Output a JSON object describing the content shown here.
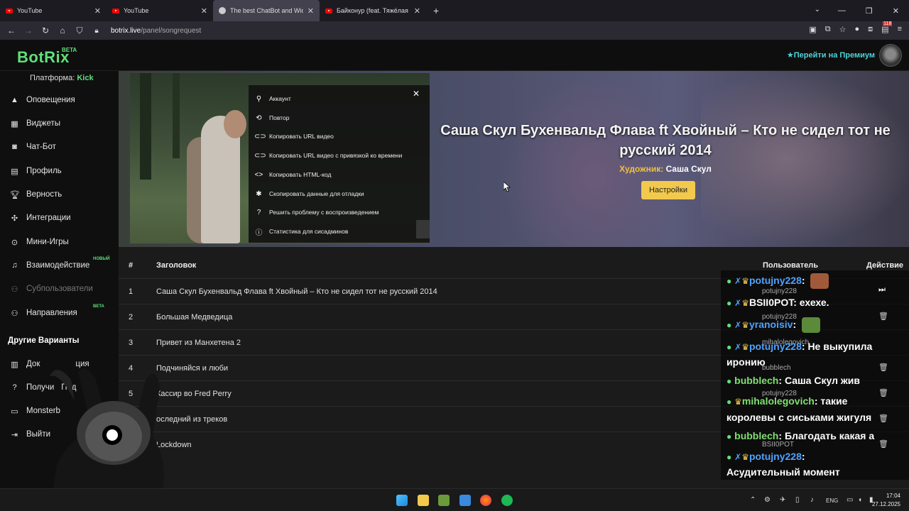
{
  "browser": {
    "tabs": [
      {
        "title": "YouTube",
        "icon": "youtube-icon"
      },
      {
        "title": "YouTube",
        "icon": "youtube-icon"
      },
      {
        "title": "The best ChatBot and Widg",
        "icon": "botrix-icon"
      },
      {
        "title": "Байконур (feat. Тяжёлая Атлет",
        "icon": "youtube-icon"
      }
    ],
    "url_host": "botrix.live",
    "url_path": "/panel/songrequest",
    "extension_badge": "118"
  },
  "app": {
    "logo": "BotRix",
    "logo_badge": "BETA",
    "premium_label": "Перейти на Премиум"
  },
  "sidebar": {
    "platform_label": "Платформа:",
    "platform_value": "Kick",
    "items": [
      {
        "label": "Оповещения",
        "icon": "warning-icon"
      },
      {
        "label": "Виджеты",
        "icon": "widgets-icon"
      },
      {
        "label": "Чат-Бот",
        "icon": "robot-icon"
      },
      {
        "label": "Профиль",
        "icon": "profile-card-icon"
      },
      {
        "label": "Верность",
        "icon": "trophy-icon"
      },
      {
        "label": "Интеграции",
        "icon": "integrations-icon"
      },
      {
        "label": "Мини-Игры",
        "icon": "gamepad-icon"
      },
      {
        "label": "Взаимодействие",
        "icon": "music-icon",
        "badge": "НОВЫЙ"
      },
      {
        "label": "Субпользователи",
        "icon": "users-icon"
      },
      {
        "label": "Направления",
        "icon": "users-icon",
        "badge": "BETA"
      }
    ],
    "section_title": "Другие Варианты",
    "extra": [
      {
        "label": "Док",
        "suffix": "ция",
        "icon": "docs-icon"
      },
      {
        "label": "Получи",
        "suffix": "Под",
        "tail": "у",
        "icon": "help-icon"
      },
      {
        "label": "Monsterb",
        "icon": "monitor-icon"
      },
      {
        "label": "Выйти",
        "icon": "logout-icon"
      }
    ]
  },
  "context_menu": {
    "items": [
      {
        "label": "Аккаунт",
        "icon": "user-icon"
      },
      {
        "label": "Повтор",
        "icon": "repeat-icon"
      },
      {
        "label": "Копировать URL видео",
        "icon": "link-icon"
      },
      {
        "label": "Копировать URL видео с привязкой ко времени",
        "icon": "link-icon"
      },
      {
        "label": "Копировать HTML-код",
        "icon": "code-icon"
      },
      {
        "label": "Скопировать данные для отладки",
        "icon": "bug-icon"
      },
      {
        "label": "Решить проблему с воспроизведением",
        "icon": "question-icon"
      },
      {
        "label": "Статистика для сисадминов",
        "icon": "info-icon"
      }
    ]
  },
  "now_playing": {
    "title": "Саша Скул Бухенвальд Флава ft Хвойный – Кто не сидел тот не русский 2014",
    "artist_label": "Художник:",
    "artist": "Саша Скул",
    "settings_label": "Настройки"
  },
  "queue": {
    "headers": {
      "num": "#",
      "title": "Заголовок",
      "user": "Пользователь",
      "action": "Действие"
    },
    "rows": [
      {
        "num": "1",
        "title": "Саша Скул Бухенвальд Флава ft Хвойный – Кто не сидел тот не русский 2014"
      },
      {
        "num": "2",
        "title": "Большая Медведица"
      },
      {
        "num": "3",
        "title": "Привет из Манхетена 2"
      },
      {
        "num": "4",
        "title": "Подчиняйся и люби"
      },
      {
        "num": "5",
        "title": "Кассир во Fred Perry"
      },
      {
        "num": "",
        "title": "оследний из треков"
      },
      {
        "num": "",
        "title": "Lockdown"
      }
    ],
    "row_users": [
      "potujny228",
      "potujny228",
      "mihalolegovich",
      "bubblech",
      "potujny228",
      "BSII0POT"
    ]
  },
  "chat": {
    "messages": [
      {
        "user": "potujny228",
        "text": "",
        "color": "#4da3ff"
      },
      {
        "user": "BSII0POT",
        "text": "ехехе.",
        "color": "#ffffff"
      },
      {
        "user": "yranoisiv",
        "text": "",
        "color": "#4da3ff"
      },
      {
        "user": "potujny228",
        "text": "Не выкупила",
        "cont": "иронию",
        "color": "#4da3ff"
      },
      {
        "user": "bubblech",
        "text": "Саша Скул жив",
        "color": "#7fe070"
      },
      {
        "user": "mihalolegovich",
        "text": "такие",
        "cont": "королевы с сиськами жигуля",
        "color": "#7fe070"
      },
      {
        "user": "bubblech",
        "text": "Благодать какая а",
        "color": "#7fe070"
      },
      {
        "user": "potujny228",
        "text": "",
        "cont": "Асудительный момент",
        "color": "#4da3ff"
      }
    ]
  },
  "taskbar": {
    "lang": "ENG",
    "time": "17:04",
    "date": "27.12.2025"
  }
}
